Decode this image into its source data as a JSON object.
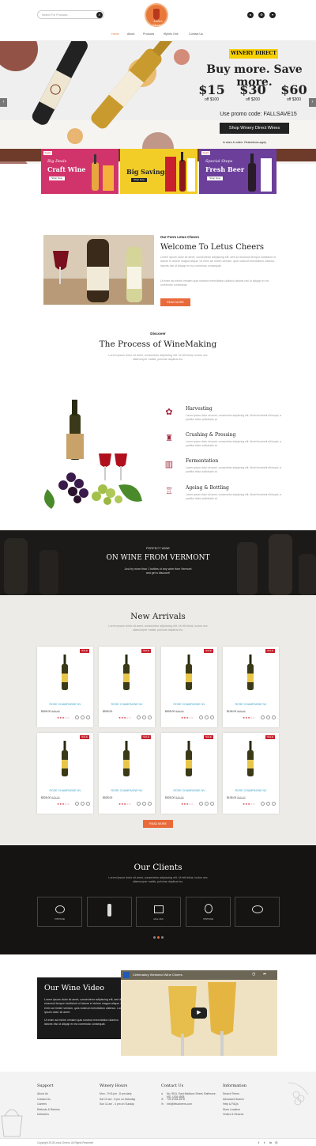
{
  "header": {
    "search_placeholder": "Search For Products...",
    "logo_text": "Letus Cheers",
    "nav": [
      "Home",
      "About",
      "Products",
      "Spirits One",
      "Contact Us"
    ]
  },
  "hero": {
    "badge": "WINERY DIRECT",
    "headline": "Buy more. Save more.",
    "offers": [
      {
        "price": "$15",
        "label": "off $100"
      },
      {
        "price": "$30",
        "label": "off $200"
      },
      {
        "price": "$60",
        "label": "off $300"
      }
    ],
    "promo": "Use promo code: FALLSAVE15",
    "shop_button": "Shop Winery Direct Wines",
    "restriction": "In store & online. Restrictions apply."
  },
  "tiles": [
    {
      "badge": "Deals",
      "line1": "Big Deals",
      "line2": "Craft Wine",
      "button": "Shop Now",
      "bg": "#d1346a"
    },
    {
      "badge": "",
      "line1": "",
      "line2": "Big Savings",
      "button": "Shop Now",
      "bg": "#f3cd27"
    },
    {
      "badge": "Deals",
      "line1": "Special Steps",
      "line2": "Fresh Beer",
      "button": "Shop Now",
      "bg": "#6b3f9a"
    }
  ],
  "welcome": {
    "eyebrow": "Our Form Letus Cheers",
    "title": "Welcome To Letus Cheers",
    "para1": "Lorem ipsum dolor sit amet, consectetur adipiscing elit, sed do eiusmod tempor incididunt ut labore et dolore magna aliqua. Ut enim ad minim veniam, quis nostrud exercitation ullamco laboris nisi ut aliquip ex ea commodo consequat.",
    "para2": "Ut enim ad minim veniam quis nostrud exercitation ullamco laboris nisi ut aliquip ex ea commodo consequat.",
    "button": "READ MORE"
  },
  "process": {
    "eyebrow": "Discover",
    "title": "The Process of WineMaking",
    "subtitle": "Lorem ipsum dolor sit amet, consectetur adipiscing elit. Ut elit tellus, luctus nec ullamcorper mattis, pulvinar dapibus leo.",
    "steps": [
      {
        "icon": "grapes-icon",
        "glyph": "✿",
        "title": "Harvesting",
        "text": "Lorem ipsum dolor sit amet, consectetur adipiscing elit. Morbi hendrerit elit turpis, a porttitor tellus sollicitudin at."
      },
      {
        "icon": "corkscrew-icon",
        "glyph": "♜",
        "title": "Crushing & Pressing",
        "text": "Lorem ipsum dolor sit amet, consectetur adipiscing elit. Morbi hendrerit elit turpis, a porttitor tellus sollicitudin at."
      },
      {
        "icon": "barrel-icon",
        "glyph": "▥",
        "title": "Fermentation",
        "text": "Lorem ipsum dolor sit amet, consectetur adipiscing elit. Morbi hendrerit elit turpis, a porttitor tellus sollicitudin at."
      },
      {
        "icon": "wine-bottle-icon",
        "glyph": "♖",
        "title": "Ageing & Bottling",
        "text": "Lorem ipsum dolor sit amet, consectetur adipiscing elit. Morbi hendrerit elit turpis, a porttitor tellus sollicitudin at."
      }
    ]
  },
  "banner": {
    "eyebrow": "PERFECT WINE",
    "title": "ON WINE FROM VERMONT",
    "text": "Just try more than 1 bottles of any wine from Vermont and get a discount!"
  },
  "arrivals": {
    "title": "New Arrivals",
    "subtitle": "Lorem ipsum dolor sit amet, consectetur adipiscing elit. Ut elit tellus, luctus nec ullamcorper mattis, pulvinar dapibus leo.",
    "products": [
      {
        "name": "ROSE CHAMPAGNE NV",
        "price": "$528.00",
        "old": "$45.00",
        "badge": "SALE"
      },
      {
        "name": "ROSE CHAMPAGNE NV",
        "price": "$528.00",
        "old": "",
        "badge": "SALE"
      },
      {
        "name": "ROSE CHAMPAGNE NV",
        "price": "$528.00",
        "old": "$45.00",
        "badge": "SALE"
      },
      {
        "name": "ROSE CHAMPAGNE NV",
        "price": "$108.00",
        "old": "$45.00",
        "badge": "SALE"
      },
      {
        "name": "ROSE CHAMPAGNE NV",
        "price": "$528.00",
        "old": "$45.00",
        "badge": "SALE"
      },
      {
        "name": "ROSE CHAMPAGNE NV",
        "price": "$528.00",
        "old": "",
        "badge": "SALE"
      },
      {
        "name": "ROSE CHAMPAGNE NV",
        "price": "$528.00",
        "old": "$45.00",
        "badge": "SALE"
      },
      {
        "name": "ROSE CHAMPAGNE NV",
        "price": "$108.00",
        "old": "$45.00",
        "badge": "SALE"
      }
    ],
    "button": "READ MORE"
  },
  "clients": {
    "title": "Our Clients",
    "text1": "Lorem ipsum dolor sit amet, consectetur adipiscing elit. Ut elit tellus, luctus nec ullamcorper mattis, pulvinar dapibus leo.",
    "logos": [
      "VINTAGE",
      "",
      "wine club",
      "VINTAGE",
      ""
    ]
  },
  "video": {
    "title": "Our Wine Video",
    "text1": "Lorem ipsum dolor sit amet, consectetur adipiscing elit, sed do eiusmod tempor incididunt ut labore et dolore magna aliqua. Ut enim ad minim veniam, quis nostrud exercitation ullamco. Lorem ipsum dolor sit amet.",
    "text2": "Ut enim ad minim veniam quis nostrud exercitation ullamco laboris nisi ut aliquip ex ea commodo consequat.",
    "video_title": "Celebratory Weekend Wine Cheers"
  },
  "footer": {
    "support": {
      "title": "Support",
      "links": [
        "About Us",
        "Contact Us",
        "Careers",
        "Refunds & Returns",
        "Deliveries"
      ]
    },
    "hours": {
      "title": "Winery Hours",
      "links": [
        "Mon - Fri 8 pm - 8 pm daily",
        "Sat 10 am - 5 pm on Saturday",
        "Sun 11 am - 4 pm on Sunday"
      ]
    },
    "contact": {
      "title": "Contact Us",
      "links": [
        "No: 58 A, East Madison Street, Baltimore, MD, USA 4508",
        "+00 6748-4578",
        "info@letusheers.com"
      ]
    },
    "info": {
      "title": "Information",
      "links": [
        "Search Terms",
        "Advanced Search",
        "Help & FAQs",
        "Store Location",
        "Orders & Returns"
      ]
    },
    "copyright": "Copyright 2018 Letus Cheers. All Rights Reserved"
  }
}
